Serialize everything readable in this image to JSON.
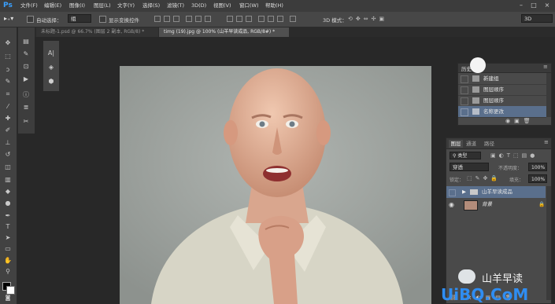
{
  "app": {
    "logo": "Ps"
  },
  "menu": [
    "文件(F)",
    "编辑(E)",
    "图像(I)",
    "图层(L)",
    "文字(Y)",
    "选择(S)",
    "滤镜(T)",
    "3D(D)",
    "视图(V)",
    "窗口(W)",
    "帮助(H)"
  ],
  "options": {
    "auto_select_label": "自动选择：",
    "auto_select_value": "组",
    "show_transform_label": "显示变换控件",
    "mode_3d_label": "3D 模式：",
    "workspace_value": "3D"
  },
  "tabs": [
    {
      "label": "未标题-1.psd @ 66.7% (图层 2 副本, RGB/8) *",
      "active": false
    },
    {
      "label": "timg (19).jpg @ 100% (山羊早读成品, RGB/8#) *",
      "active": true
    }
  ],
  "history": {
    "title": "历史",
    "items": [
      "新建组",
      "图层顺序",
      "图层顺序",
      "名称更改"
    ]
  },
  "layers": {
    "tabs": [
      "图层",
      "通道",
      "路径"
    ],
    "filter_label": "类型",
    "blend_mode": "穿透",
    "opacity_label": "不透明度：",
    "opacity_value": "100%",
    "lock_label": "锁定：",
    "fill_label": "填充：",
    "fill_value": "100%",
    "items": [
      {
        "name": "山羊早读成品",
        "type": "group",
        "selected": true
      },
      {
        "name": "背景",
        "type": "layer",
        "selected": false
      }
    ]
  },
  "watermark": {
    "chinese": "山羊早读",
    "latin": "UiBQ.CoM"
  },
  "colors": {
    "accent": "#3aa0ff",
    "selected_row": "#5a6f8c",
    "panel": "#4a4a4a"
  }
}
